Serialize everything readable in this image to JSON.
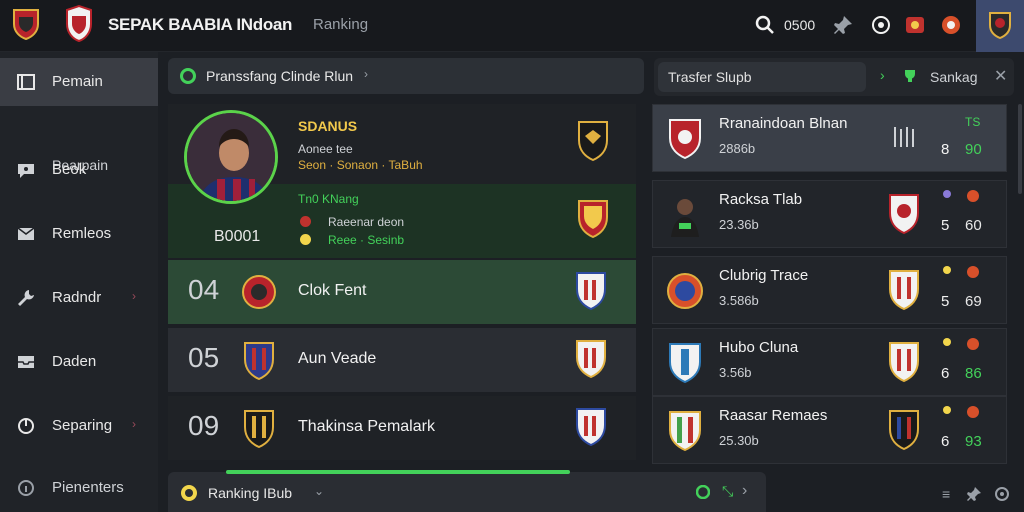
{
  "header": {
    "brand": "SEPAK BAABIA INdoan",
    "breadcrumb": "Ranking",
    "counter": "0500"
  },
  "sidebar": {
    "items": [
      {
        "label": "Pemain",
        "icon": "roster-icon"
      },
      {
        "label": "Beok",
        "icon": "chat-icon"
      },
      {
        "label": "Remleos",
        "icon": "mail-icon"
      },
      {
        "label": "Radndr",
        "icon": "wrench-icon"
      },
      {
        "label": "Daden",
        "icon": "inbox-icon"
      },
      {
        "label": "Separing",
        "icon": "power-icon"
      },
      {
        "label": "Pienenters",
        "icon": "info-icon"
      }
    ],
    "sub_label": "Pearpain"
  },
  "middle": {
    "panel_title": "Pranssfang Clinde Rlun",
    "player": {
      "name": "SDANUS",
      "line1": "Aonee tee",
      "line2": "Seon · Sonaon · TaBuh",
      "score": "B0001",
      "stat_title": "Tn0 KNang",
      "stat1": "Raeenar deon",
      "stat2": "Reee · Sesinb"
    },
    "rows": [
      {
        "rank": "04",
        "name": "Clok Fent"
      },
      {
        "rank": "05",
        "name": "Aun Veade"
      },
      {
        "rank": "09",
        "name": "Thakinsa Pemalark"
      }
    ],
    "footer_label": "Ranking IBub"
  },
  "right": {
    "search_text": "Trasfer Slupb",
    "label": "Sankag",
    "cards": [
      {
        "title": "Rranaindoan Blnan",
        "sub": "2886b",
        "stat_a": "8",
        "stat_b": "90",
        "top": "TS"
      },
      {
        "title": "Racksa Tlab",
        "sub": "23.36b",
        "stat_a": "5",
        "stat_b": "60"
      },
      {
        "title": "Clubrig Trace",
        "sub": "3.586b",
        "stat_a": "5",
        "stat_b": "69"
      },
      {
        "title": "Hubo Cluna",
        "sub": "3.56b",
        "stat_a": "6",
        "stat_b": "86"
      },
      {
        "title": "Raasar Remaes",
        "sub": "25.30b",
        "stat_a": "6",
        "stat_b": "93"
      }
    ]
  },
  "colors": {
    "accent_green": "#43d15a",
    "gold": "#f2c94c",
    "highlight_row": "#2c4a36"
  }
}
